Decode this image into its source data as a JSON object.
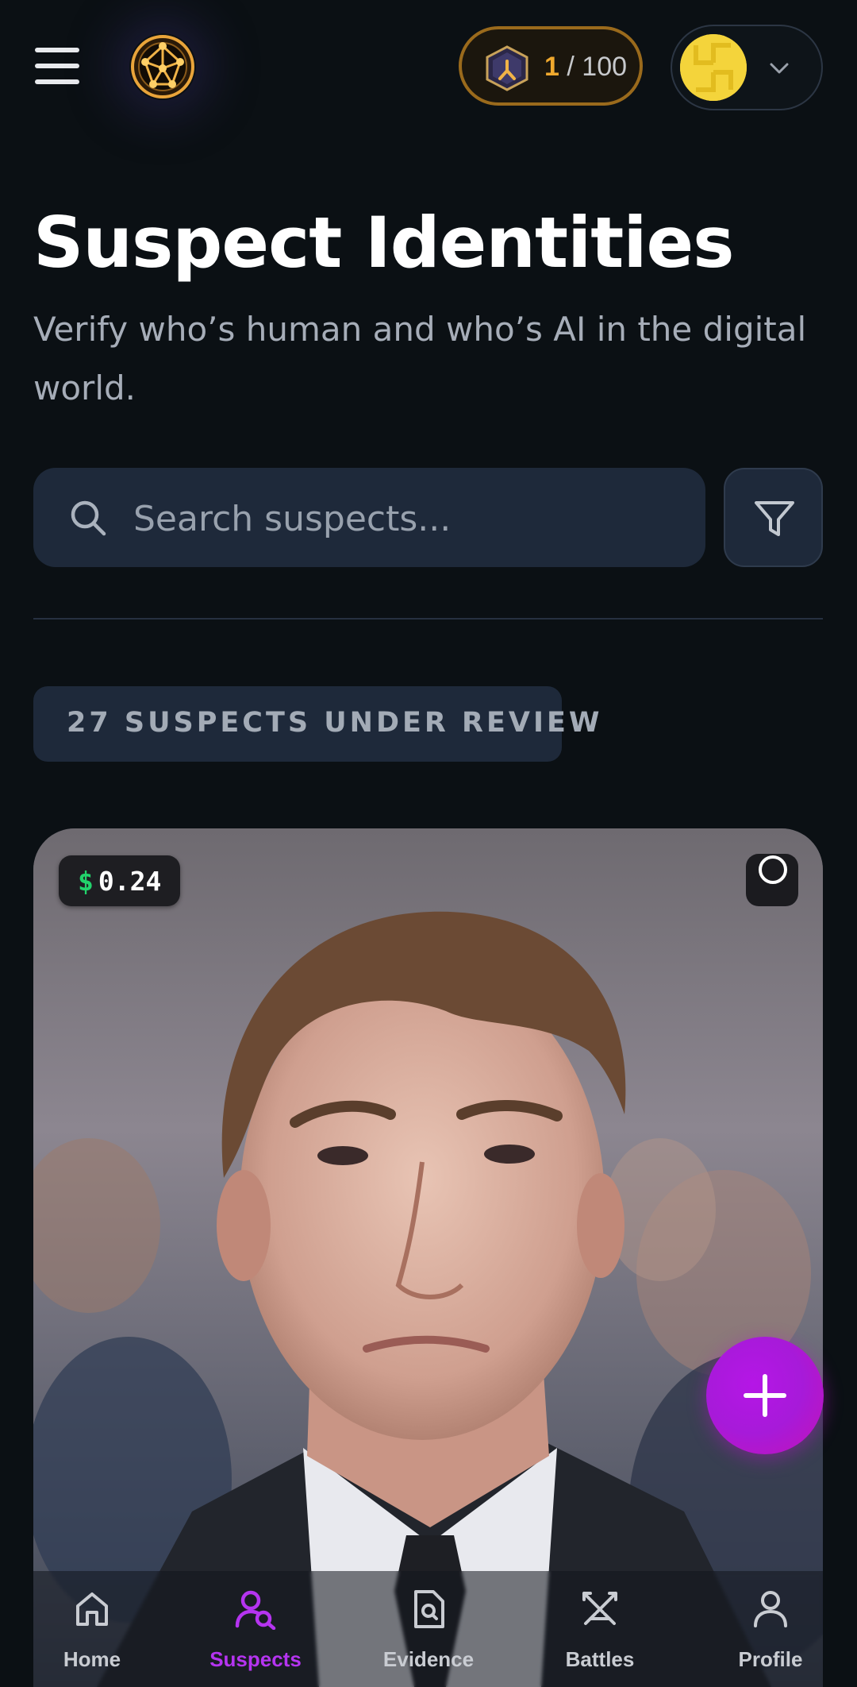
{
  "header": {
    "menu_icon": "hamburger-menu-icon",
    "logo_icon": "network-star-logo",
    "score": {
      "current": "1",
      "separator": "/",
      "total": "100",
      "badge_icon": "rank-badge-icon",
      "accent": "#f0a92e"
    },
    "account": {
      "avatar_icon": "wallet-avatar",
      "chevron_icon": "chevron-down-icon"
    }
  },
  "page": {
    "title": "Suspect Identities",
    "subtitle": "Verify who’s human and who’s AI in the digital world."
  },
  "search": {
    "placeholder": "Search suspects...",
    "value": "",
    "icon": "search-icon",
    "filter_icon": "filter-icon"
  },
  "summary": {
    "count_label": "27 SUSPECTS UNDER REVIEW"
  },
  "card": {
    "price_symbol": "$",
    "price_value": "0.24",
    "status_icon": "circle-status-icon",
    "photo": "suspect-portrait-photo"
  },
  "fab": {
    "icon": "plus-icon",
    "color": "#b516e6"
  },
  "nav": {
    "items": [
      {
        "label": "Home",
        "icon": "home-icon",
        "active": false
      },
      {
        "label": "Suspects",
        "icon": "suspect-search-icon",
        "active": true
      },
      {
        "label": "Evidence",
        "icon": "evidence-document-icon",
        "active": false
      },
      {
        "label": "Battles",
        "icon": "crossed-swords-icon",
        "active": false
      },
      {
        "label": "Profile",
        "icon": "profile-icon",
        "active": false
      }
    ],
    "active_color": "#b534f0"
  }
}
